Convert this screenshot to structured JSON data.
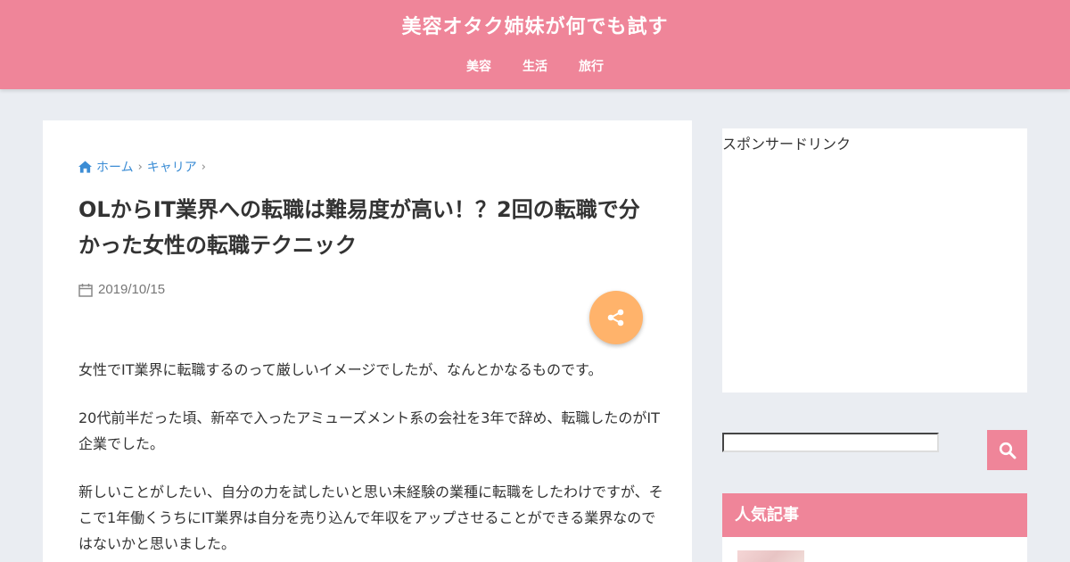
{
  "header": {
    "site_title": "美容オタク姉妹が何でも試す",
    "nav": [
      "美容",
      "生活",
      "旅行"
    ]
  },
  "breadcrumb": {
    "home": "ホーム",
    "category": "キャリア"
  },
  "article": {
    "title": "OLからIT業界への転職は難易度が高い！？2回の転職で分かった女性の転職テクニック",
    "date": "2019/10/15",
    "paragraphs": [
      "女性でIT業界に転職するのって厳しいイメージでしたが、なんとかなるものです。",
      "20代前半だった頃、新卒で入ったアミューズメント系の会社を3年で辞め、転職したのがIT企業でした。",
      "新しいことがしたい、自分の力を試したいと思い未経験の業種に転職をしたわけですが、そこで1年働くうちにIT業界は自分を売り込んで年収をアップさせることができる業界なのではないかと思いました。"
    ]
  },
  "sidebar": {
    "ad_label": "スポンサードリンク",
    "search_value": "",
    "popular_title": "人気記事"
  },
  "colors": {
    "brand_pink": "#ef8599",
    "share_orange": "#ffb36b",
    "link_blue": "#3c8dd5",
    "page_bg": "#eaedf2"
  },
  "icons": {
    "home": "home-icon",
    "calendar": "calendar-icon",
    "share": "share-icon",
    "search": "search-icon",
    "chevron": "chevron-right-icon"
  }
}
